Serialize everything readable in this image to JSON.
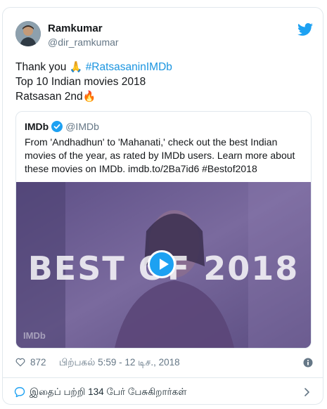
{
  "author": {
    "name": "Ramkumar",
    "handle": "@dir_ramkumar",
    "avatar_icon": "user-avatar"
  },
  "brand_icon": "twitter-bird-icon",
  "tweet": {
    "line1_text": "Thank you ",
    "line1_emoji": "🙏",
    "line1_hashtag": "#RatsasaninIMDb",
    "line2": "Top 10 Indian movies 2018",
    "line3_text": "Ratsasan 2nd",
    "line3_emoji": "🔥"
  },
  "quoted": {
    "name": "IMDb",
    "handle": "@IMDb",
    "text": "From 'Andhadhun' to 'Mahanati,' check out the best Indian movies of the year, as rated by IMDb users. Learn more about these movies on IMDb. imdb.to/2Ba7id6 #Bestof2018",
    "media_title": "BEST OF 2018",
    "watermark": "IMDb"
  },
  "meta": {
    "likes": "872",
    "timestamp": "பிற்பகல் 5:59 - 12 டிச., 2018"
  },
  "footer": {
    "conversation": "இதைப் பற்றி 134 பேர் பேசுகிறார்கள்"
  },
  "colors": {
    "link": "#1b95e0",
    "twitter_blue": "#1da1f2",
    "secondary_text": "#657786",
    "border": "#e1e8ed"
  }
}
